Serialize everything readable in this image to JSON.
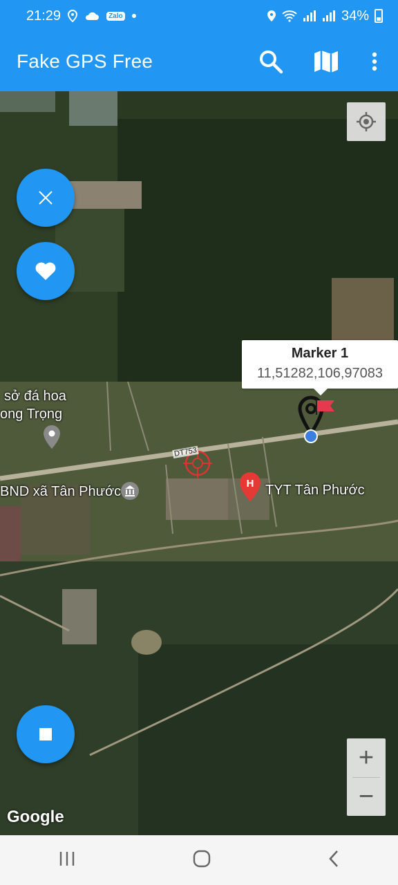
{
  "status_bar": {
    "time": "21:29",
    "app_badge": "Zalo",
    "battery": "34%"
  },
  "app_bar": {
    "title": "Fake GPS Free",
    "actions": [
      "search-icon",
      "map-icon",
      "more-vert-icon"
    ]
  },
  "map": {
    "marker": {
      "title": "Marker 1",
      "coordinates": "11,51282,106,97083"
    },
    "labels": {
      "poi_1_line1": "sở đá hoa",
      "poi_1_line2": "ong Trọng",
      "ubnd": "BND xã Tân Phước",
      "clinic": "TYT Tân Phước",
      "road": "DT753"
    },
    "attribution": "Google",
    "zoom_in": "+",
    "zoom_out": "−"
  },
  "colors": {
    "primary": "#2196f3",
    "marker_flag": "#e53950",
    "poi_red": "#e53935"
  }
}
